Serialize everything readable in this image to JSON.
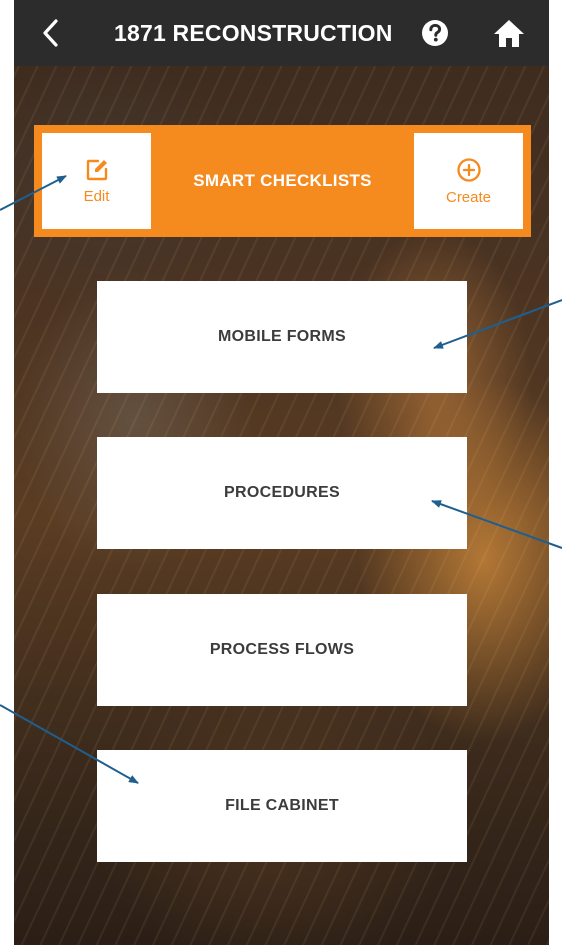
{
  "header": {
    "title": "1871 RECONSTRUCTION",
    "back_icon": "chevron-left-icon",
    "help_icon": "question-circle-icon",
    "home_icon": "home-icon"
  },
  "smart_checklists": {
    "title": "SMART CHECKLISTS",
    "edit_label": "Edit",
    "create_label": "Create",
    "edit_icon": "edit-icon",
    "create_icon": "plus-circle-icon",
    "accent_color": "#f58a1f"
  },
  "menu": {
    "items": [
      {
        "label": "MOBILE FORMS"
      },
      {
        "label": "PROCEDURES"
      },
      {
        "label": "PROCESS FLOWS"
      },
      {
        "label": "FILE CABINET"
      }
    ]
  },
  "colors": {
    "header_bg": "#2c2c2c",
    "accent": "#f58a1f",
    "button_text": "#3c3c3c",
    "annotation_arrow": "#1f5f8f"
  }
}
